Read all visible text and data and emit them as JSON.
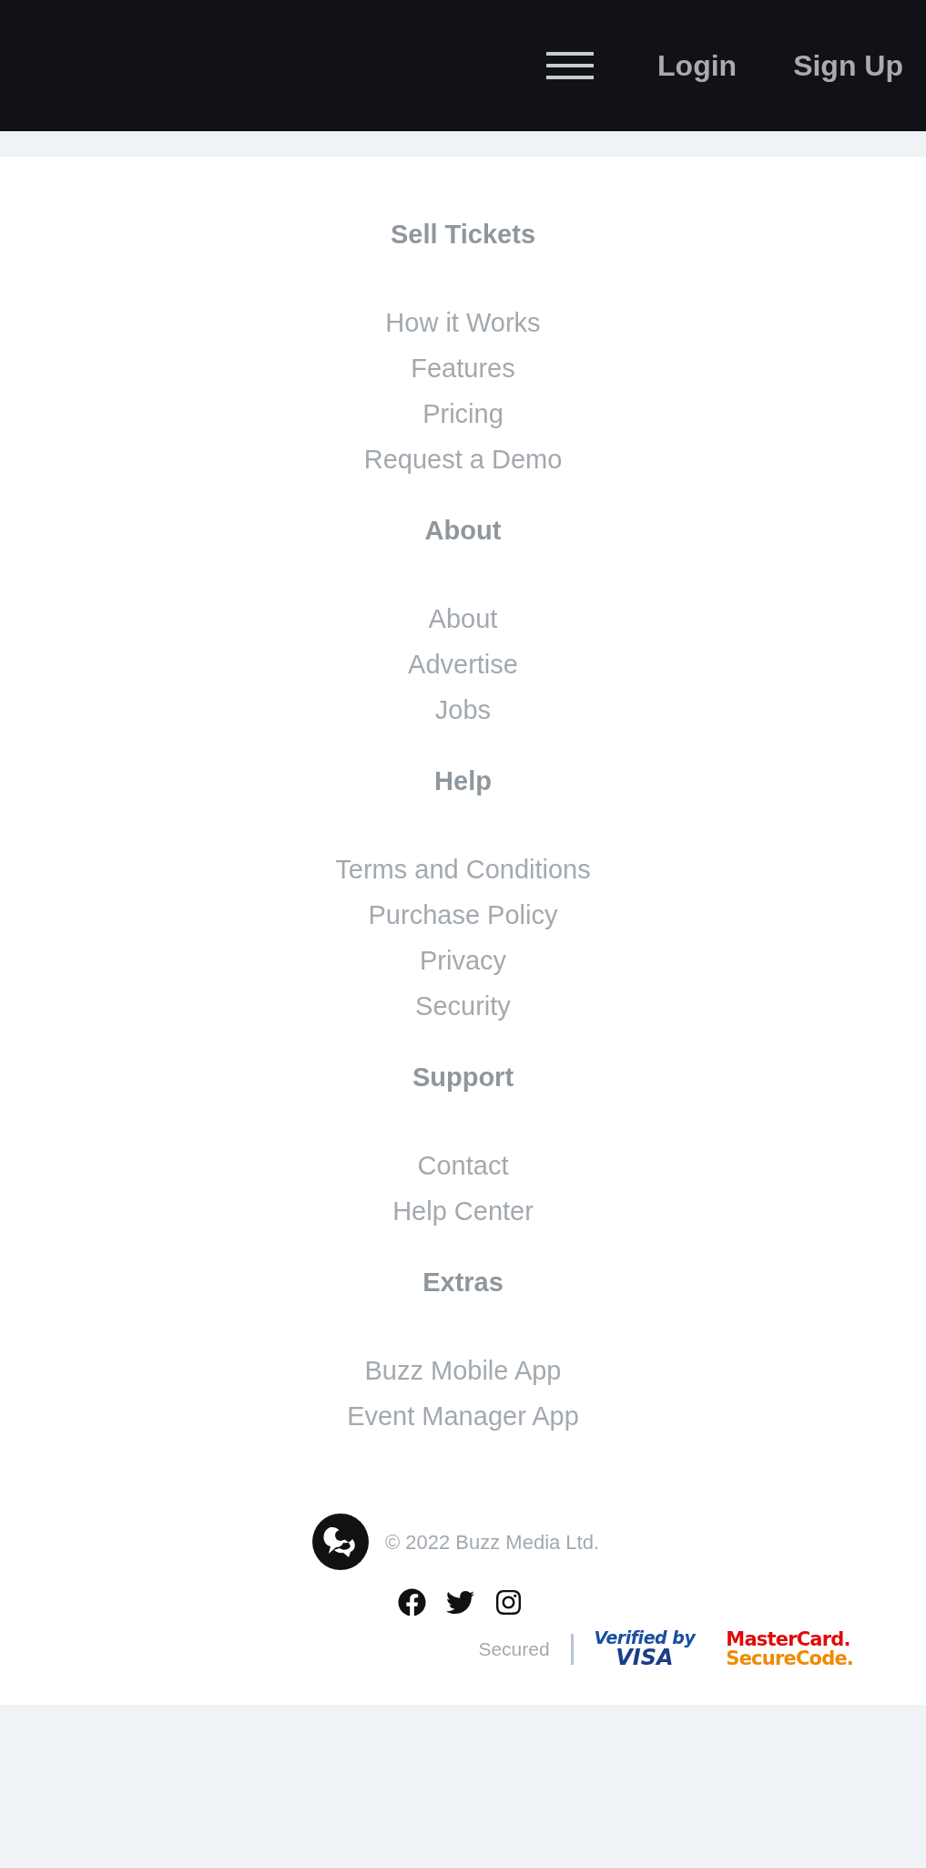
{
  "header": {
    "nav": [
      {
        "label": "Login"
      },
      {
        "label": "Sign Up"
      }
    ]
  },
  "footer": {
    "sections": [
      {
        "title": "Sell Tickets",
        "links": [
          "How it Works",
          "Features",
          "Pricing",
          "Request a Demo"
        ]
      },
      {
        "title": "About",
        "links": [
          "About",
          "Advertise",
          "Jobs"
        ]
      },
      {
        "title": "Help",
        "links": [
          "Terms and Conditions",
          "Purchase Policy",
          "Privacy",
          "Security"
        ]
      },
      {
        "title": "Support",
        "links": [
          "Contact",
          "Help Center"
        ]
      },
      {
        "title": "Extras",
        "links": [
          "Buzz Mobile App",
          "Event Manager App"
        ]
      }
    ],
    "copyright": "© 2022 Buzz Media Ltd.",
    "security": {
      "label": "Secured",
      "badges": [
        {
          "kind": "visa",
          "lines": [
            "Verified by",
            "VISA"
          ]
        },
        {
          "kind": "mastercard",
          "lines": [
            "MasterCard.",
            "SecureCode."
          ]
        }
      ]
    }
  }
}
